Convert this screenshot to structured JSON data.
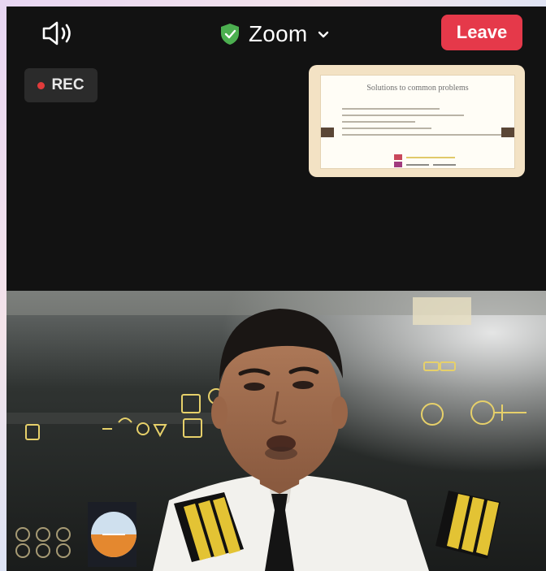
{
  "meeting": {
    "title": "Zoom",
    "leave_label": "Leave",
    "recording_label": "REC"
  },
  "icons": {
    "speaker": "speaker-icon",
    "security": "shield-check-icon",
    "dropdown": "chevron-down-icon",
    "recording": "recording-dot-icon"
  },
  "colors": {
    "leave_button": "#e5394a",
    "security_shield": "#4caf50",
    "recording_dot": "#e13b3b",
    "window_background": "#121212"
  },
  "shared_screen": {
    "slide_title": "Solutions to common problems"
  }
}
